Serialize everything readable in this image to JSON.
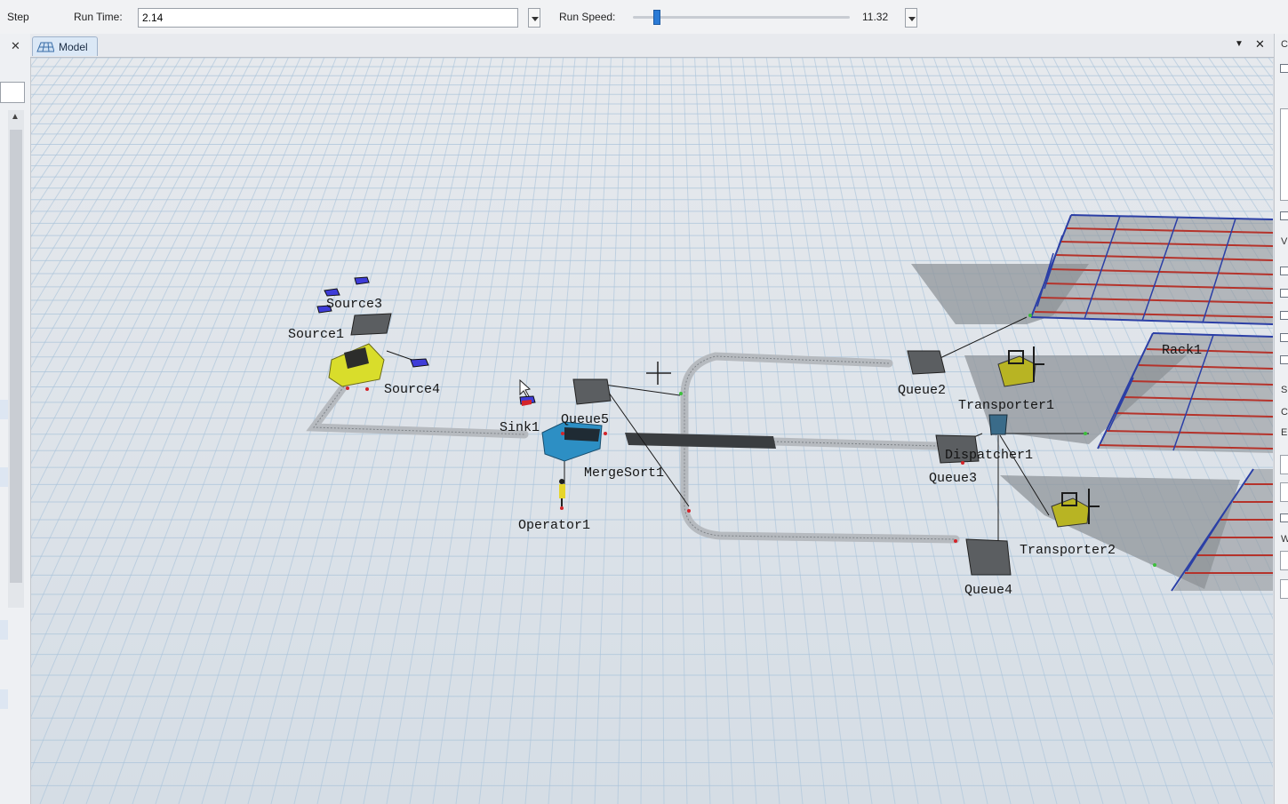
{
  "toolbar": {
    "step_label": "Step",
    "run_time_label": "Run Time:",
    "run_time_value": "2.14",
    "run_speed_label": "Run Speed:",
    "run_speed_value": "11.32"
  },
  "tabs": [
    {
      "label": "Model",
      "active": true
    }
  ],
  "model_objects": {
    "source3": "Source3",
    "source1": "Source1",
    "source4": "Source4",
    "sink1": "Sink1",
    "queue5": "Queue5",
    "mergesort1": "MergeSort1",
    "operator1": "Operator1",
    "queue2": "Queue2",
    "transporter1": "Transporter1",
    "dispatcher1": "Dispatcher1",
    "queue3": "Queue3",
    "transporter2": "Transporter2",
    "queue4": "Queue4",
    "rack1": "Rack1"
  },
  "right_panel_letters": [
    "C",
    "V",
    "S",
    "C",
    "E",
    "W"
  ],
  "icons": {
    "model_tab": "grid-floor-icon",
    "close": "close-icon",
    "dropdown": "chevron-down-icon",
    "forklift": "forklift-icon",
    "rack": "rack-icon",
    "conveyor": "conveyor-icon",
    "crosshair": "crosshair-icon"
  },
  "colors": {
    "accent": "#2b7bd6",
    "floor_grid": "#a9c3da",
    "rack_red": "#b5332b",
    "rack_blue": "#2b3fa6",
    "merge_sort_blue": "#2d8fc4",
    "source_yellow": "#d9dd2b"
  }
}
